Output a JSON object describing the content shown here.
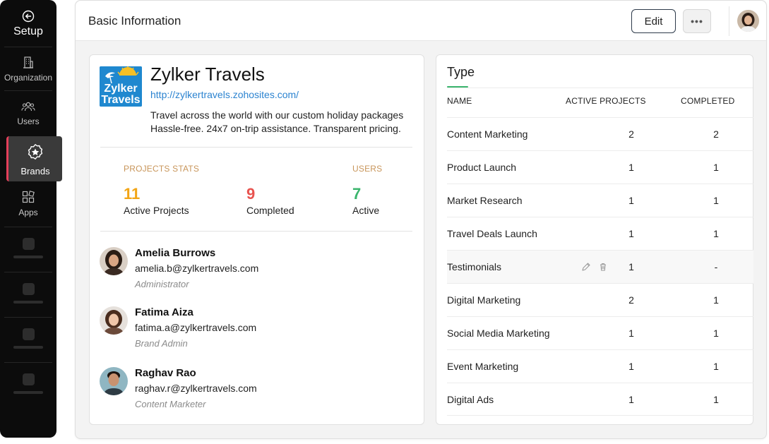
{
  "sidebar": {
    "title": "Setup",
    "items": [
      {
        "label": "Organization"
      },
      {
        "label": "Users"
      },
      {
        "label": "Brands"
      },
      {
        "label": "Apps"
      }
    ],
    "active_accent": "#e43f5a"
  },
  "header": {
    "title": "Basic Information",
    "edit_label": "Edit",
    "more_label": "•••"
  },
  "brand": {
    "logo_text_line1": "Zylker",
    "logo_text_line2": "Travels",
    "name": "Zylker Travels",
    "url": "http://zylkertravels.zohosites.com/",
    "description_line1": "Travel across the world with our custom holiday packages",
    "description_line2": "Hassle-free. 24x7 on-trip assistance. Transparent pricing.",
    "logo_color": "#1f88cf"
  },
  "stats": {
    "projects_label": "PROJECTS STATS",
    "users_label": "USERS",
    "active_projects": {
      "value": "11",
      "caption": "Active Projects",
      "color": "#f2a516"
    },
    "completed": {
      "value": "9",
      "caption": "Completed",
      "color": "#e8534f"
    },
    "active_users": {
      "value": "7",
      "caption": "Active",
      "color": "#3bb56d"
    }
  },
  "users": [
    {
      "name": "Amelia Burrows",
      "email": "amelia.b@zylkertravels.com",
      "role": "Administrator"
    },
    {
      "name": "Fatima Aiza",
      "email": "fatima.a@zylkertravels.com",
      "role": "Brand Admin"
    },
    {
      "name": "Raghav Rao",
      "email": "raghav.r@zylkertravels.com",
      "role": "Content Marketer"
    }
  ],
  "type_table": {
    "title": "Type",
    "headers": {
      "name": "NAME",
      "active": "ACTIVE PROJECTS",
      "completed": "COMPLETED"
    },
    "rows": [
      {
        "name": "Content Marketing",
        "active": "2",
        "completed": "2"
      },
      {
        "name": "Product Launch",
        "active": "1",
        "completed": "1"
      },
      {
        "name": "Market Research",
        "active": "1",
        "completed": "1"
      },
      {
        "name": "Travel Deals Launch",
        "active": "1",
        "completed": "1"
      },
      {
        "name": "Testimonials",
        "active": "1",
        "completed": "-"
      },
      {
        "name": "Digital Marketing",
        "active": "2",
        "completed": "1"
      },
      {
        "name": "Social Media Marketing",
        "active": "1",
        "completed": "1"
      },
      {
        "name": "Event Marketing",
        "active": "1",
        "completed": "1"
      },
      {
        "name": "Digital Ads",
        "active": "1",
        "completed": "1"
      }
    ],
    "accent": "#3bb56d"
  }
}
